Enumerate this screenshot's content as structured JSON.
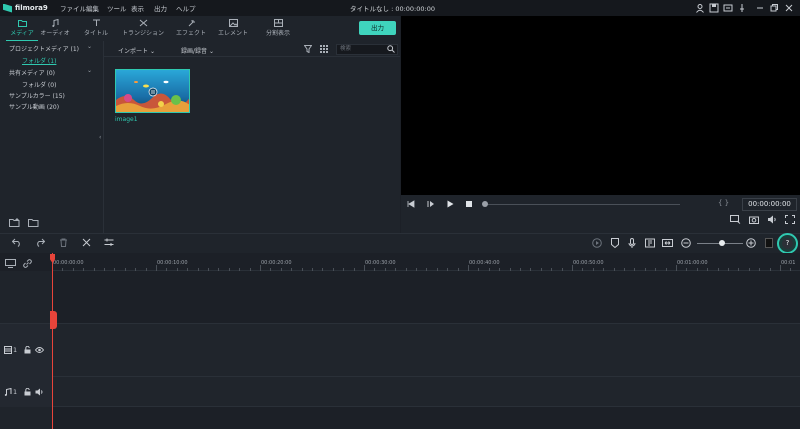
{
  "app": {
    "name": "filmora9"
  },
  "menu": [
    "ファイル",
    "編集",
    "ツール",
    "表示",
    "出力",
    "ヘルプ"
  ],
  "document_title": "タイトルなし : 00:00:00:00",
  "tabs": [
    {
      "label": "メディア",
      "icon": "folder-icon",
      "active": true
    },
    {
      "label": "オーディオ",
      "icon": "music-note-icon",
      "active": false
    },
    {
      "label": "タイトル",
      "icon": "text-title-icon",
      "active": false
    },
    {
      "label": "トランジション",
      "icon": "transition-icon",
      "active": false
    },
    {
      "label": "エフェクト",
      "icon": "effect-icon",
      "active": false
    },
    {
      "label": "エレメント",
      "icon": "element-image-icon",
      "active": false
    },
    {
      "label": "分割表示",
      "icon": "split-screen-icon",
      "active": false
    }
  ],
  "export_label": "出力",
  "sidebar": {
    "items": [
      {
        "label": "プロジェクトメディア (1)",
        "expandable": true
      },
      {
        "label": "フォルダ (1)",
        "selected": true
      },
      {
        "label": "共有メディア (0)",
        "expandable": true
      },
      {
        "label": "フォルダ (0)"
      },
      {
        "label": "サンプルカラー (15)"
      },
      {
        "label": "サンプル動画 (20)"
      }
    ]
  },
  "media_toolbar": {
    "import_label": "インポート",
    "record_label": "録画/録音",
    "search_placeholder": "検索"
  },
  "media_items": [
    {
      "label": "image1"
    }
  ],
  "preview": {
    "timecode": "00:00:00:00",
    "brackets": "{ }"
  },
  "timeline": {
    "ruler_labels": [
      "00:00:00:00",
      "00:00:10:00",
      "00:00:20:00",
      "00:00:30:00",
      "00:00:40:00",
      "00:00:50:00",
      "00:01:00:00",
      "00:01"
    ],
    "zoom_level": 0.55,
    "tracks": [
      {
        "label": "1",
        "type": "video"
      },
      {
        "label": "1",
        "type": "audio"
      }
    ],
    "help_label": "?"
  },
  "colors": {
    "accent": "#2fc9b0",
    "playhead": "#e8443a",
    "background": "#1c2027"
  }
}
